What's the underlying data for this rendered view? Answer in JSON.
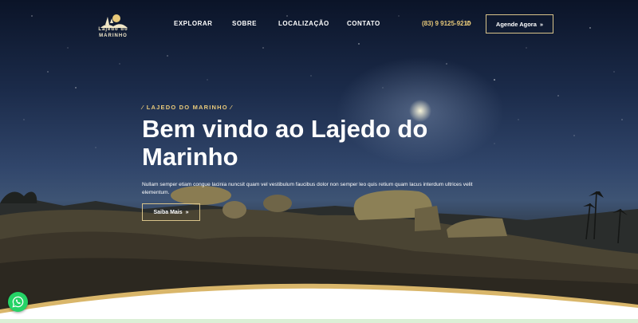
{
  "header": {
    "logo_lines": [
      "Lajedo do",
      "MARINHO"
    ],
    "nav": [
      {
        "label": "EXPLORAR"
      },
      {
        "label": "SOBRE"
      },
      {
        "label": "LOCALIZAÇÃO"
      },
      {
        "label": "CONTATO"
      }
    ],
    "phone": "(83) 9 9125-9210",
    "phone_icon": "phone-icon",
    "cta_label": "Agende Agora",
    "cta_icon": "double-chevron-right-icon"
  },
  "hero": {
    "eyebrow": "LAJEDO DO MARINHO",
    "title": "Bem vindo ao Lajedo do Marinho",
    "description": "Nullam semper etiam congue lacinia nuncsit quam vel vestibulum faucibus dolor non semper leo quis retium quam lacus interdum ultrices velit elementum.",
    "button_label": "Saiba Mais",
    "button_icon": "double-chevron-right-icon"
  },
  "floating": {
    "whatsapp_icon": "whatsapp-icon"
  },
  "colors": {
    "accent_gold": "#e8c97a",
    "button_border": "#d8c38a",
    "whatsapp_green": "#25d366",
    "sky_dark": "#0b1428"
  }
}
